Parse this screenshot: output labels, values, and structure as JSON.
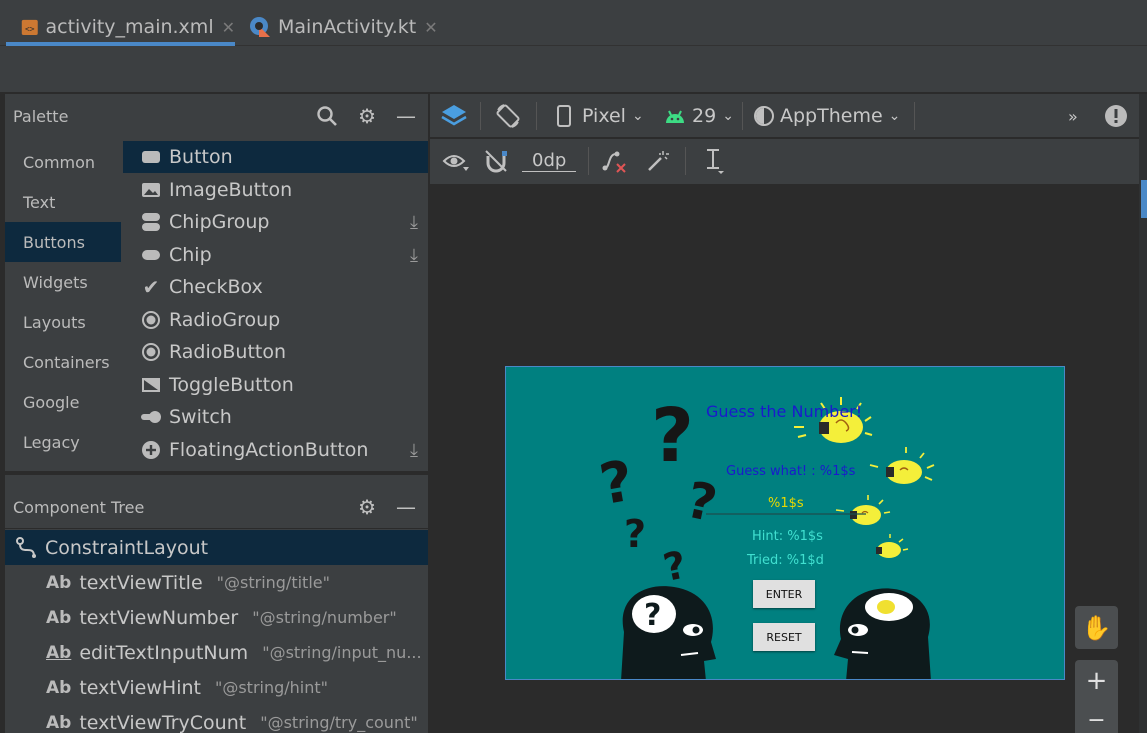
{
  "tabs": [
    {
      "label": "activity_main.xml",
      "icon": "xml-file-icon",
      "active": true
    },
    {
      "label": "MainActivity.kt",
      "icon": "kotlin-file-icon",
      "active": false
    }
  ],
  "palette": {
    "title": "Palette",
    "categories": [
      "Common",
      "Text",
      "Buttons",
      "Widgets",
      "Layouts",
      "Containers",
      "Google",
      "Legacy"
    ],
    "active_category": "Buttons",
    "items": [
      {
        "label": "Button",
        "icon": "button-icon"
      },
      {
        "label": "ImageButton",
        "icon": "image-icon"
      },
      {
        "label": "ChipGroup",
        "icon": "chip-group-icon",
        "download": true
      },
      {
        "label": "Chip",
        "icon": "chip-icon",
        "download": true
      },
      {
        "label": "CheckBox",
        "icon": "checkmark-icon"
      },
      {
        "label": "RadioGroup",
        "icon": "radio-icon"
      },
      {
        "label": "RadioButton",
        "icon": "radio-icon"
      },
      {
        "label": "ToggleButton",
        "icon": "toggle-button-icon"
      },
      {
        "label": "Switch",
        "icon": "switch-icon"
      },
      {
        "label": "FloatingActionButton",
        "icon": "plus-circle-icon",
        "download": true
      }
    ]
  },
  "component_tree": {
    "title": "Component Tree",
    "root": "ConstraintLayout",
    "rows": [
      {
        "name": "textViewTitle",
        "ref": "\"@string/title\"",
        "icon": "Ab"
      },
      {
        "name": "textViewNumber",
        "ref": "\"@string/number\"",
        "icon": "Ab"
      },
      {
        "name": "editTextInputNum",
        "ref": "\"@string/input_nu...",
        "icon": "Ab"
      },
      {
        "name": "textViewHint",
        "ref": "\"@string/hint\"",
        "icon": "Ab"
      },
      {
        "name": "textViewTryCount",
        "ref": "\"@string/try_count\"",
        "icon": "Ab"
      }
    ]
  },
  "toolbar": {
    "device": "Pixel",
    "api": "29",
    "theme": "AppTheme",
    "margin": "0dp"
  },
  "preview": {
    "title": "Guess the Number!",
    "guess_text": "Guess what! : %1$s",
    "number_text": "%1$s",
    "hint_text": "Hint: %1$s",
    "tried_text": "Tried: %1$d",
    "enter_label": "ENTER",
    "reset_label": "RESET",
    "colors": {
      "background": "#008080",
      "title": "#1a1acc",
      "number": "#e8d800",
      "hint": "#40e0d0"
    }
  }
}
